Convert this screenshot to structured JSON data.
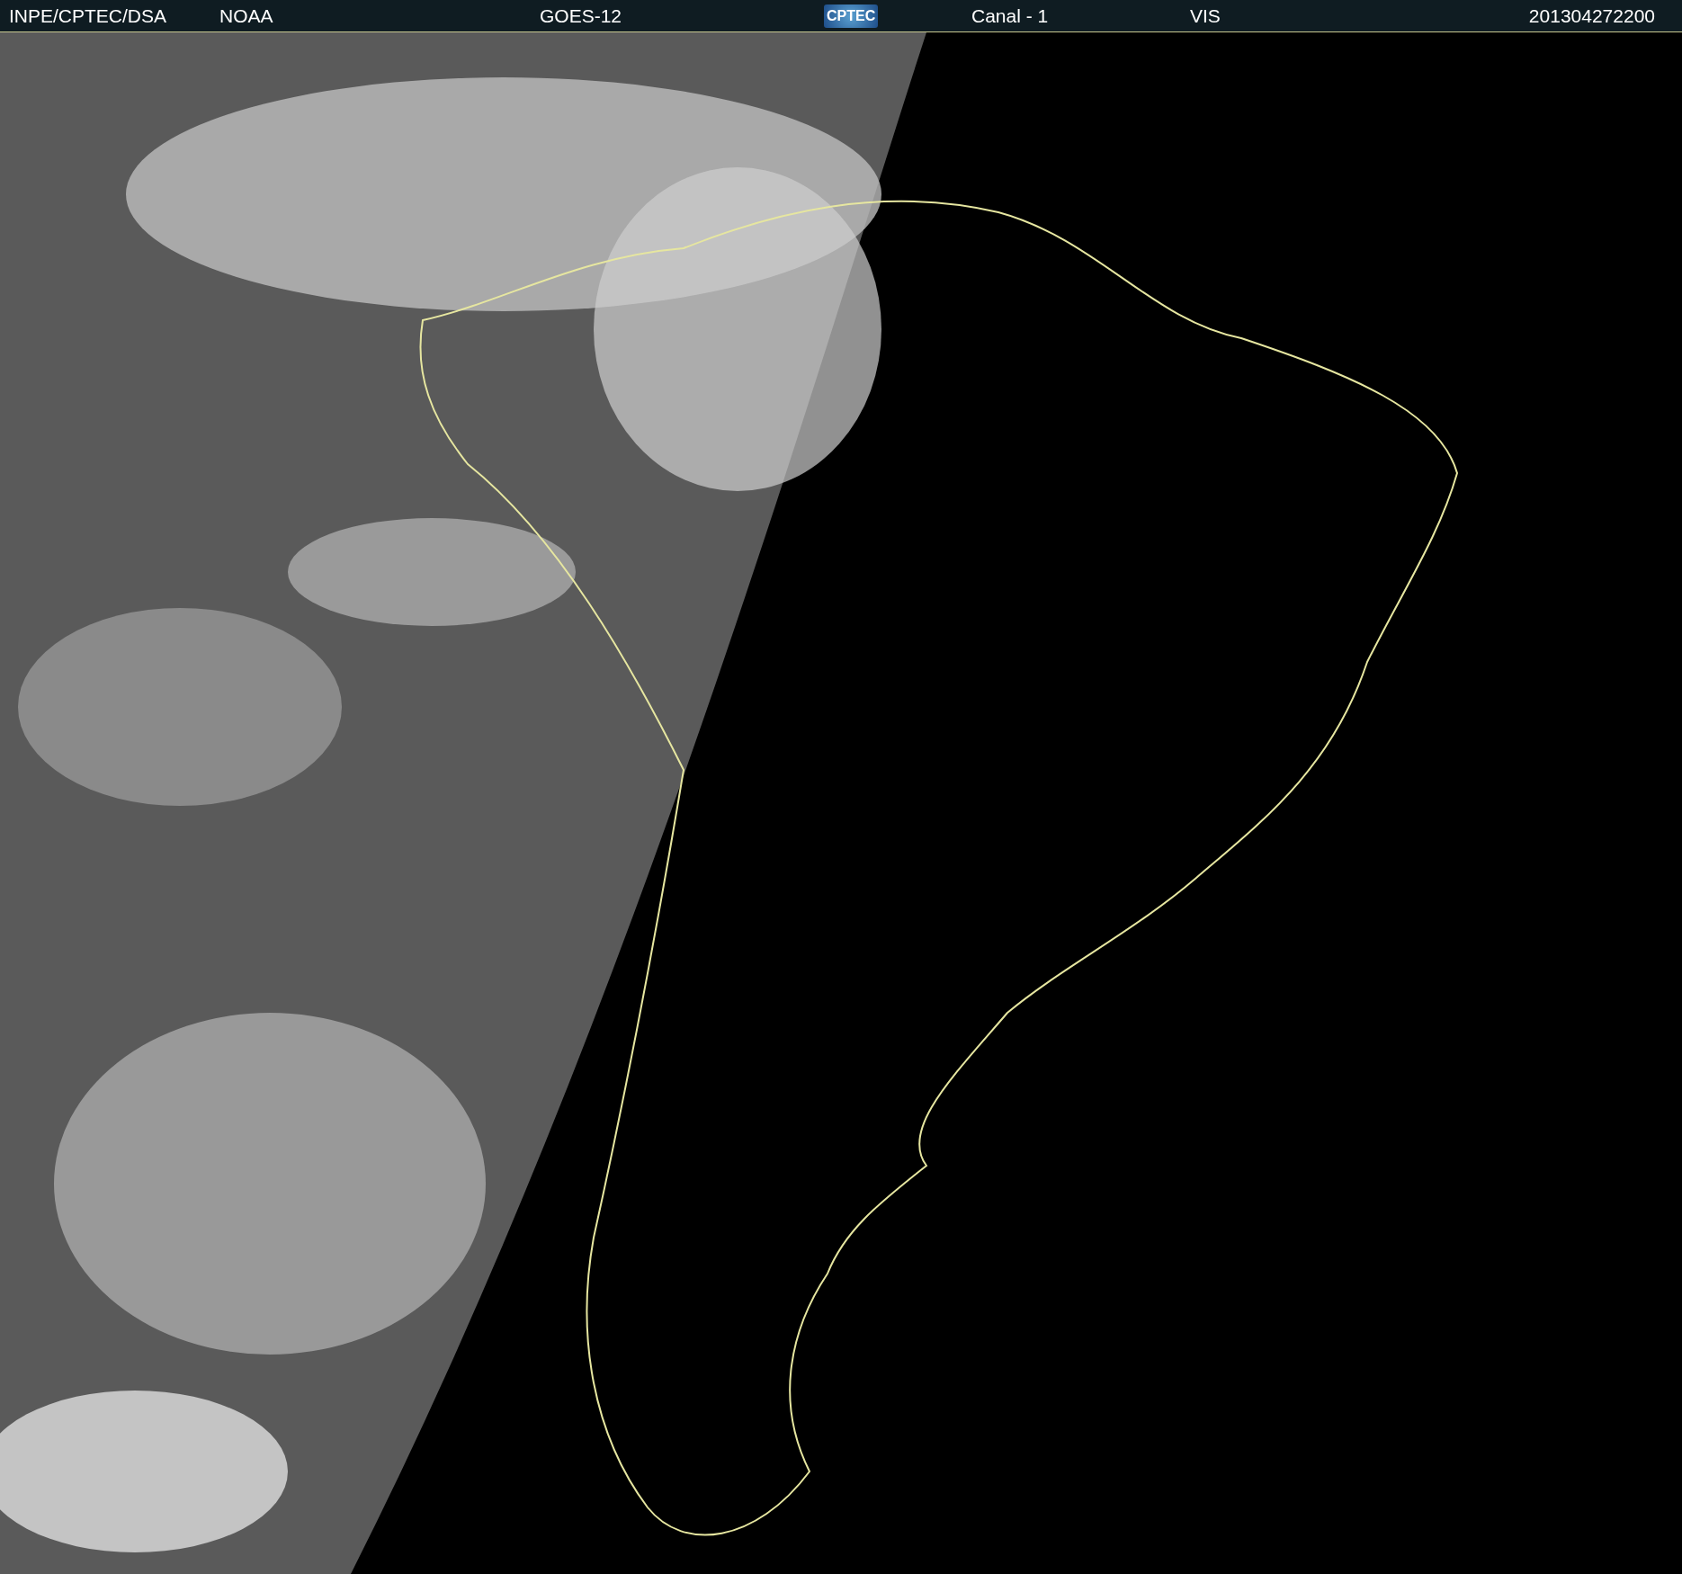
{
  "header": {
    "items": [
      {
        "kind": "text",
        "text": "INPE/CPTEC/DSA"
      },
      {
        "kind": "text",
        "text": "NOAA"
      },
      {
        "kind": "text",
        "text": "GOES-12"
      },
      {
        "kind": "logo",
        "text": "CPTEC"
      },
      {
        "kind": "text",
        "text": "Canal - 1"
      },
      {
        "kind": "text",
        "text": "VIS"
      },
      {
        "kind": "text",
        "text": "201304272200"
      }
    ]
  }
}
